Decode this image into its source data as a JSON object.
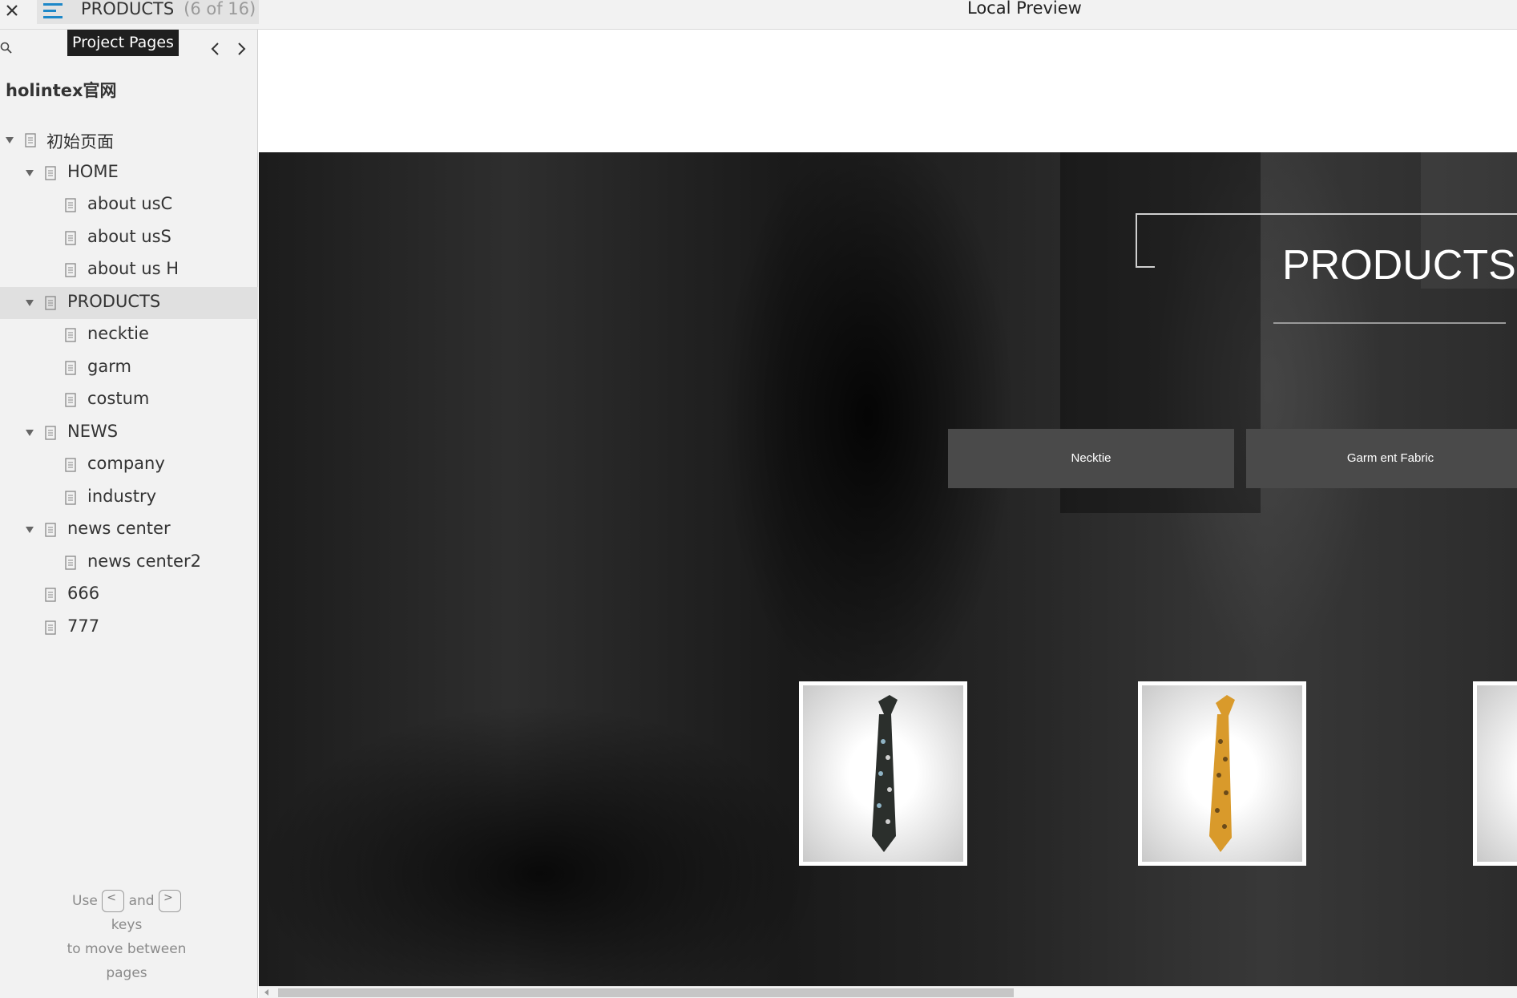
{
  "topbar": {
    "page_title": "PRODUCTS",
    "page_count": "(6 of 16)",
    "preview_title": "Local Preview"
  },
  "sidebar": {
    "tooltip": "Project Pages",
    "project_name": "holintex官网",
    "tree": [
      {
        "label": "初始页面",
        "level": 0,
        "expanded": true
      },
      {
        "label": "HOME",
        "level": 1,
        "expanded": true
      },
      {
        "label": "about usC",
        "level": 2
      },
      {
        "label": "about usS",
        "level": 2
      },
      {
        "label": "about us H",
        "level": 2
      },
      {
        "label": "PRODUCTS",
        "level": 1,
        "expanded": true,
        "selected": true
      },
      {
        "label": "necktie",
        "level": 2
      },
      {
        "label": "garm",
        "level": 2
      },
      {
        "label": "costum",
        "level": 2
      },
      {
        "label": "NEWS",
        "level": 1,
        "expanded": true
      },
      {
        "label": "company",
        "level": 2
      },
      {
        "label": "industry",
        "level": 2
      },
      {
        "label": "news center",
        "level": 1,
        "expanded": true
      },
      {
        "label": "news center2",
        "level": 2
      },
      {
        "label": "666",
        "level": 1
      },
      {
        "label": "777",
        "level": 1
      }
    ],
    "hint": {
      "use": "Use",
      "and": "and",
      "keys": "keys",
      "line2": "to move between",
      "line3": "pages",
      "key_prev": "<",
      "key_next": ">"
    }
  },
  "preview": {
    "heading": "PRODUCTS",
    "categories": [
      "Necktie",
      "Garm ent Fabric"
    ],
    "products": [
      {
        "tie_color": "#2b2f2c",
        "pattern_color": "#8fb3c4"
      },
      {
        "tie_color": "#d99a2b",
        "pattern_color": "#6a4a1a"
      }
    ]
  },
  "colors": {
    "accent": "#1e88c8",
    "selected_row": "#e0e0e0",
    "category_button": "#4a4a4a"
  }
}
